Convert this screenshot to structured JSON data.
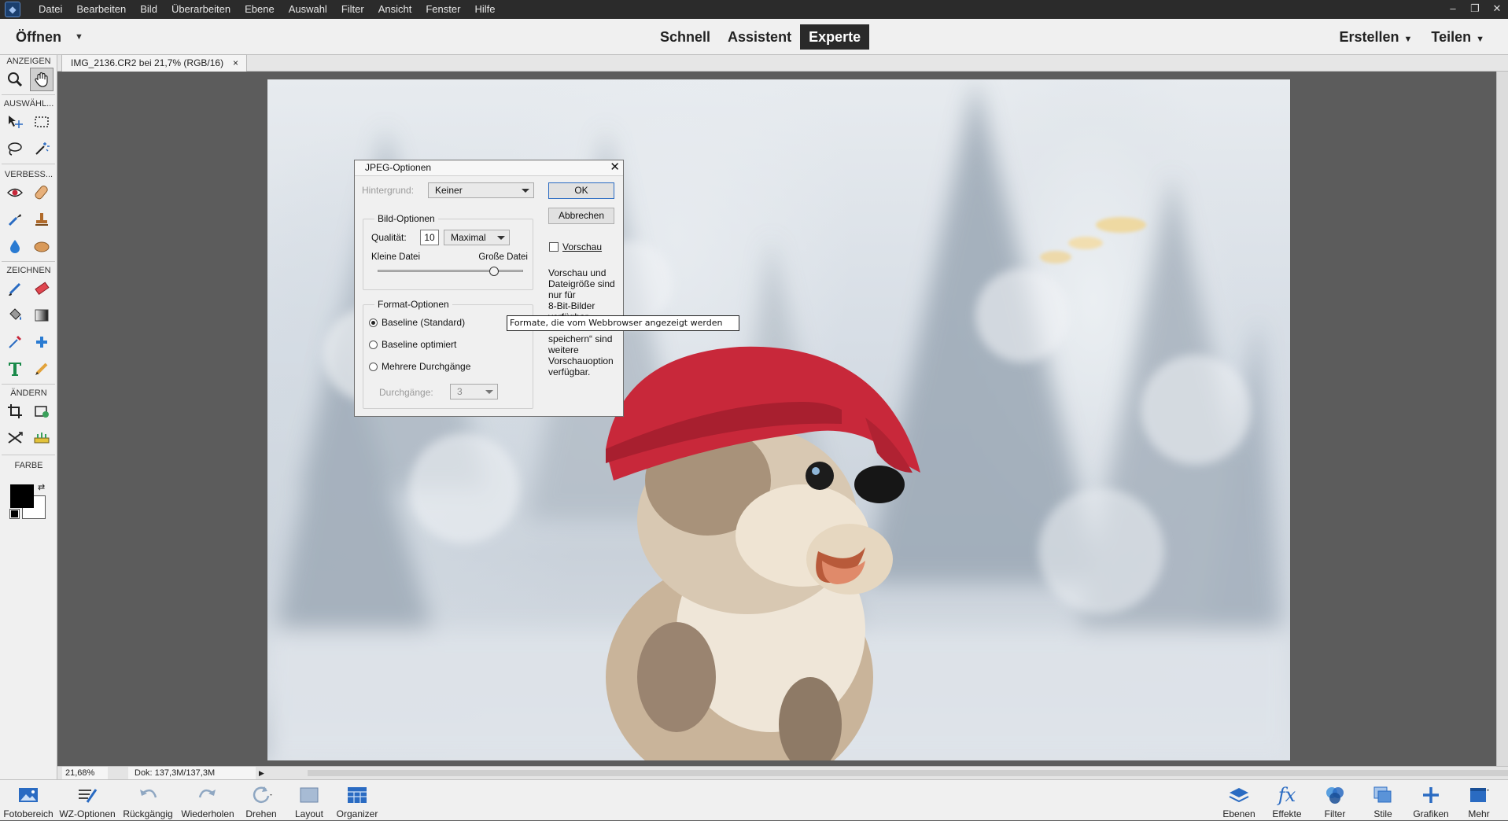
{
  "menubar": {
    "items": [
      "Datei",
      "Bearbeiten",
      "Bild",
      "Überarbeiten",
      "Ebene",
      "Auswahl",
      "Filter",
      "Ansicht",
      "Fenster",
      "Hilfe"
    ]
  },
  "topbar": {
    "open_label": "Öffnen",
    "modes": [
      "Schnell",
      "Assistent",
      "Experte"
    ],
    "active_mode": "Experte",
    "create_label": "Erstellen",
    "share_label": "Teilen"
  },
  "toolbox": {
    "sections": [
      "ANZEIGEN",
      "AUSWÄHL...",
      "VERBESS...",
      "ZEICHNEN",
      "ÄNDERN",
      "FARBE"
    ],
    "foreground_color": "#000000",
    "background_color": "#ffffff"
  },
  "document": {
    "tab_title": "IMG_2136.CR2 bei 21,7% (RGB/16)",
    "close_glyph": "×"
  },
  "status": {
    "zoom": "21,68%",
    "doc_size": "Dok: 137,3M/137,3M"
  },
  "dialog": {
    "title": "JPEG-Optionen",
    "background_label": "Hintergrund:",
    "background_value": "Keiner",
    "ok_label": "OK",
    "cancel_label": "Abbrechen",
    "preview_label": "Vorschau",
    "preview_checked": false,
    "image_options": {
      "title": "Bild-Optionen",
      "quality_label": "Qualität:",
      "quality_value": "10",
      "quality_preset": "Maximal",
      "small_file_label": "Kleine Datei",
      "large_file_label": "Große Datei",
      "slider_fraction": 0.8
    },
    "format_options": {
      "title": "Format-Optionen",
      "options": [
        "Baseline (Standard)",
        "Baseline optimiert",
        "Mehrere Durchgänge"
      ],
      "selected_index": 0,
      "passes_label": "Durchgänge:",
      "passes_value": "3"
    },
    "note_lines": [
      "Vorschau und",
      "Dateigröße sind",
      "nur für",
      "8-Bit-Bilder",
      "verfügbar.",
      "Web",
      "speichern“ sind",
      "weitere",
      "Vorschauoption",
      "verfügbar."
    ]
  },
  "tooltip": {
    "text": "Formate, die vom Webbrowser angezeigt werden"
  },
  "bottombar": {
    "left": [
      "Fotobereich",
      "WZ-Optionen",
      "Rückgängig",
      "Wiederholen",
      "Drehen",
      "Layout",
      "Organizer"
    ],
    "right": [
      "Ebenen",
      "Effekte",
      "Filter",
      "Stile",
      "Grafiken",
      "Mehr"
    ]
  },
  "colors": {
    "accent": "#2a6bc2",
    "menubar_bg": "#2b2b2b",
    "panel_bg": "#f0f0f0",
    "hat_red": "#c8283a"
  }
}
